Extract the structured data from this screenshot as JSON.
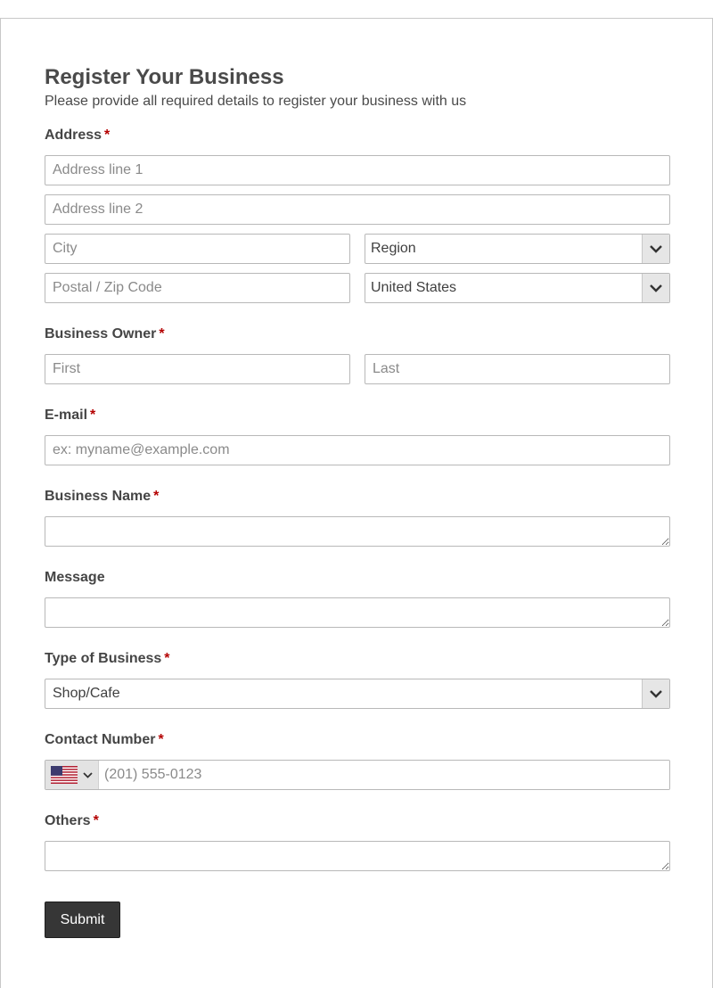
{
  "form": {
    "title": "Register Your Business",
    "subtitle": "Please provide all required details to register your business with us",
    "required_mark": "*"
  },
  "address": {
    "label": "Address",
    "line1_placeholder": "Address line 1",
    "line2_placeholder": "Address line 2",
    "city_placeholder": "City",
    "region_value": "Region",
    "postal_placeholder": "Postal / Zip Code",
    "country_value": "United States"
  },
  "owner": {
    "label": "Business Owner",
    "first_placeholder": "First",
    "last_placeholder": "Last"
  },
  "email": {
    "label": "E-mail",
    "placeholder": "ex: myname@example.com"
  },
  "business_name": {
    "label": "Business Name"
  },
  "message": {
    "label": "Message"
  },
  "business_type": {
    "label": "Type of Business",
    "value": "Shop/Cafe"
  },
  "contact": {
    "label": "Contact Number",
    "placeholder": "(201) 555-0123",
    "country_icon": "us-flag-icon"
  },
  "others": {
    "label": "Others"
  },
  "submit": {
    "label": "Submit"
  },
  "colors": {
    "required": "#b40000",
    "button": "#363636",
    "select_arrow_bg": "#e6e6e6"
  }
}
